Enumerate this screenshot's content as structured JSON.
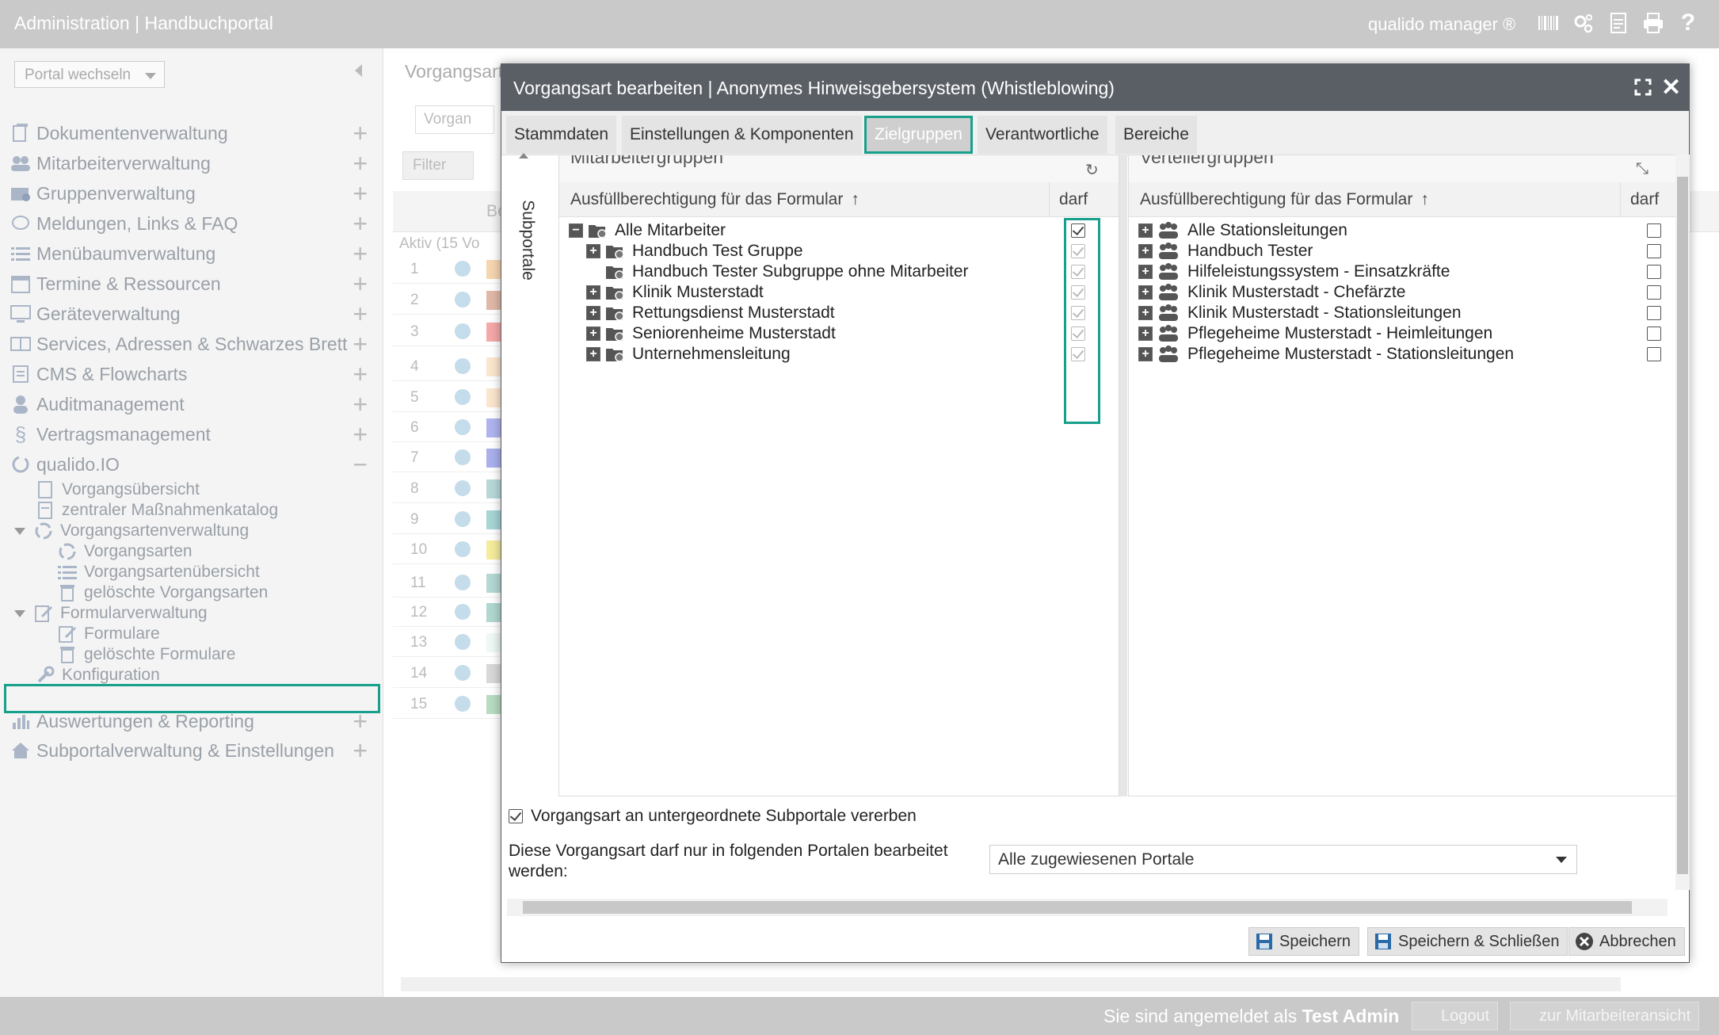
{
  "topbar": {
    "title": "Administration | Handbuchportal",
    "brand": "qualido manager ®",
    "icons": [
      "barcode-icon",
      "gears-icon",
      "document-icon",
      "printer-icon",
      "help-icon"
    ]
  },
  "sidebar": {
    "portal_switch": "Portal wechseln",
    "items": [
      {
        "label": "Dokumentenverwaltung",
        "icon": "documents-icon"
      },
      {
        "label": "Mitarbeiterverwaltung",
        "icon": "users-icon"
      },
      {
        "label": "Gruppenverwaltung",
        "icon": "group-icon"
      },
      {
        "label": "Meldungen, Links & FAQ",
        "icon": "chat-icon"
      },
      {
        "label": "Menübaumverwaltung",
        "icon": "list-icon"
      },
      {
        "label": "Termine & Ressourcen",
        "icon": "calendar-icon"
      },
      {
        "label": "Geräteverwaltung",
        "icon": "monitor-icon"
      },
      {
        "label": "Services, Adressen & Schwarzes Brett",
        "icon": "addressbook-icon"
      },
      {
        "label": "CMS & Flowcharts",
        "icon": "cms-icon"
      },
      {
        "label": "Auditmanagement",
        "icon": "auditor-icon"
      },
      {
        "label": "Vertragsmanagement",
        "icon": "paragraph-icon"
      },
      {
        "label": "qualido.IO",
        "icon": "qualido-icon"
      }
    ],
    "sub_items": [
      {
        "label": "Vorgangsübersicht",
        "icon": "document-icon"
      },
      {
        "label": "zentraler Maßnahmenkatalog",
        "icon": "catalog-icon"
      },
      {
        "label": "Vorgangsartenverwaltung",
        "icon": "cycle-icon"
      },
      {
        "label": "Vorgangsarten",
        "icon": "cycle-icon"
      },
      {
        "label": "Vorgangsartenübersicht",
        "icon": "list-icon"
      },
      {
        "label": "gelöschte Vorgangsarten",
        "icon": "trash-icon"
      },
      {
        "label": "Formularverwaltung",
        "icon": "form-edit-icon"
      },
      {
        "label": "Formulare",
        "icon": "form-edit-icon"
      },
      {
        "label": "gelöschte Formulare",
        "icon": "trash-icon"
      },
      {
        "label": "Konfiguration",
        "icon": "wrench-icon"
      }
    ],
    "bottom_items": [
      {
        "label": "Auswertungen & Reporting",
        "icon": "barchart-icon"
      },
      {
        "label": "Subportalverwaltung & Einstellungen",
        "icon": "home-icon"
      }
    ]
  },
  "main": {
    "heading": "Vorgangsart",
    "add_label": "Vorgan",
    "filter_label": "Filter",
    "col_fragment": "Be",
    "group_label": "Aktiv (15 Vo",
    "rows": [
      {
        "num": "1",
        "color": "#f6d6b0"
      },
      {
        "num": "2",
        "color": "#e0b8a8"
      },
      {
        "num": "3",
        "color": "#f4a8a8"
      },
      {
        "num": "4",
        "color": "#fbe6cf"
      },
      {
        "num": "5",
        "color": "#fbe6cf"
      },
      {
        "num": "6",
        "color": "#b0b4ee"
      },
      {
        "num": "7",
        "color": "#aab0ec"
      },
      {
        "num": "8",
        "color": "#b8d8d8"
      },
      {
        "num": "9",
        "color": "#a8d4d4"
      },
      {
        "num": "10",
        "color": "#f5ec9c"
      },
      {
        "num": "11",
        "color": "#b4d8d4"
      },
      {
        "num": "12",
        "color": "#b0d8d0"
      },
      {
        "num": "13",
        "color": "#eef8f4"
      },
      {
        "num": "14",
        "color": "#d8d8d8"
      },
      {
        "num": "15",
        "color": "#b8dcc0"
      }
    ]
  },
  "dialog": {
    "title": "Vorgangsart bearbeiten | Anonymes Hinweisgebersystem (Whistleblowing)",
    "tabs": [
      "Stammdaten",
      "Einstellungen & Komponenten",
      "Zielgruppen",
      "Verantwortliche",
      "Bereiche"
    ],
    "active_tab": "Zielgruppen",
    "side_tab": "Subportale",
    "left_panel": {
      "title": "Mitarbeitergruppen",
      "col_label": "Ausfüllberechtigung für das Formular",
      "col_darf": "darf",
      "rows": [
        {
          "label": "Alle Mitarbeiter",
          "expand": "−",
          "checked": true
        },
        {
          "label": "Handbuch Test Gruppe",
          "expand": "+",
          "checked": true
        },
        {
          "label": "Handbuch Tester Subgruppe ohne Mitarbeiter",
          "expand": "",
          "checked": true
        },
        {
          "label": "Klinik Musterstadt",
          "expand": "+",
          "checked": true
        },
        {
          "label": "Rettungsdienst Musterstadt",
          "expand": "+",
          "checked": true
        },
        {
          "label": "Seniorenheime Musterstadt",
          "expand": "+",
          "checked": true
        },
        {
          "label": "Unternehmensleitung",
          "expand": "+",
          "checked": true
        }
      ]
    },
    "right_panel": {
      "title": "Verteilergruppen",
      "col_label": "Ausfüllberechtigung für das Formular",
      "col_darf": "darf",
      "rows": [
        {
          "label": "Alle Stationsleitungen",
          "checked": false
        },
        {
          "label": "Handbuch Tester",
          "checked": false
        },
        {
          "label": "Hilfeleistungssystem - Einsatzkräfte",
          "checked": false
        },
        {
          "label": "Klinik Musterstadt - Chefärzte",
          "checked": false
        },
        {
          "label": "Klinik Musterstadt - Stationsleitungen",
          "checked": false
        },
        {
          "label": "Pflegeheime Musterstadt - Heimleitungen",
          "checked": false
        },
        {
          "label": "Pflegeheime Musterstadt - Stationsleitungen",
          "checked": false
        }
      ]
    },
    "inherit_label": "Vorgangsart an untergeordnete Subportale vererben",
    "inherit_checked": true,
    "portal_label": "Diese Vorgangsart darf nur in folgenden Portalen bearbeitet werden:",
    "portal_value": "Alle zugewiesenen Portale",
    "buttons": {
      "save": "Speichern",
      "save_close": "Speichern & Schließen",
      "cancel": "Abbrechen"
    }
  },
  "statusbar": {
    "logged_in_prefix": "Sie sind angemeldet als",
    "user": "Test Admin",
    "logout": "Logout",
    "employee_view": "zur Mitarbeiteransicht"
  },
  "colors": {
    "accent": "#17a08c",
    "dialog_title": "#5a5f66",
    "topbar": "#c9c9c9"
  }
}
